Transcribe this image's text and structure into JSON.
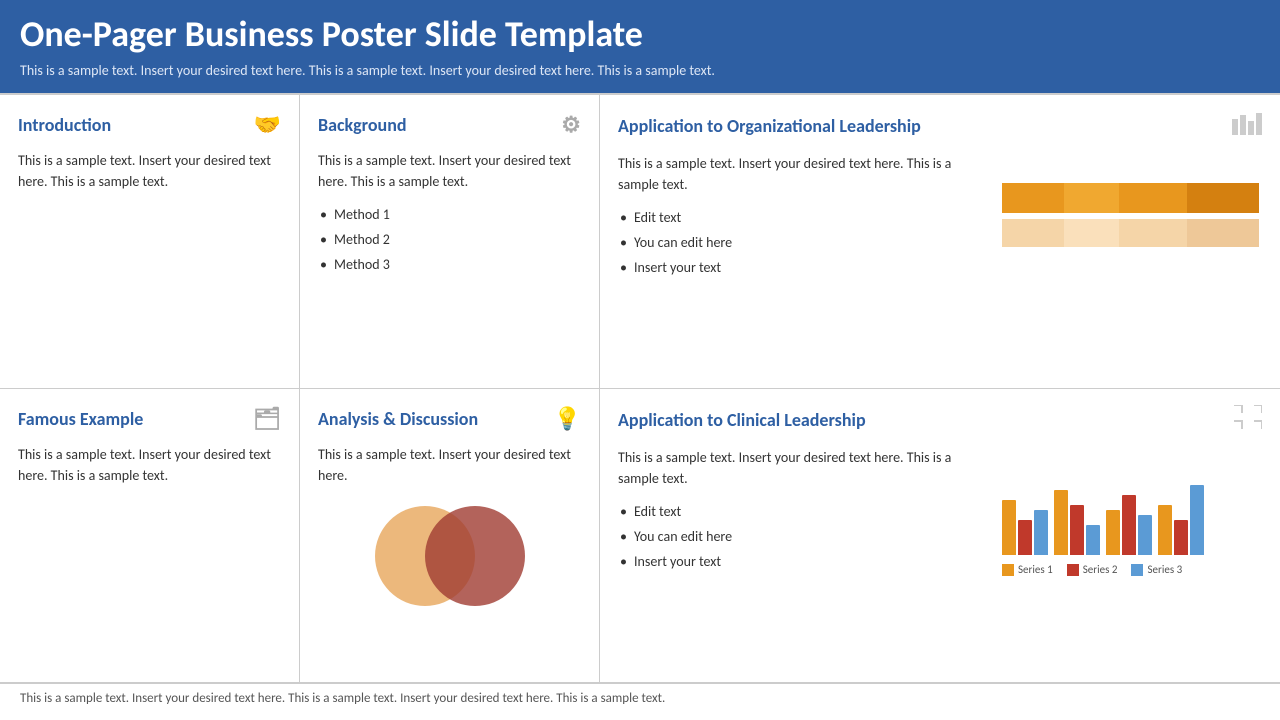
{
  "header": {
    "title": "One-Pager Business Poster Slide Template",
    "subtitle": "This is a sample text. Insert your desired text here. This is a sample text. Insert your desired text here. This is a sample text."
  },
  "sections": {
    "introduction": {
      "title": "Introduction",
      "icon": "🤝",
      "body": "This is a sample text. Insert your desired text here. This is a sample text."
    },
    "background": {
      "title": "Background",
      "icon": "⚙",
      "body": "This is a sample text. Insert your desired text here. This is a sample text.",
      "list": [
        "Method 1",
        "Method 2",
        "Method 3"
      ]
    },
    "org_leadership": {
      "title": "Application to Organizational Leadership",
      "icon": "📊",
      "body": "This is a sample text. Insert your desired text here. This is a sample text.",
      "list": [
        "Edit text",
        "You can edit here",
        "Insert your text"
      ]
    },
    "famous_example": {
      "title": "Famous Example",
      "icon": "🗂",
      "body": "This is a sample text. Insert your desired text here. This is a sample text."
    },
    "analysis": {
      "title": "Analysis & Discussion",
      "icon": "💡",
      "body": "This is a sample text. Insert your desired text here."
    },
    "clinical_leadership": {
      "title": "Application to Clinical Leadership",
      "icon": "🔀",
      "body": "This is a sample text. Insert your desired text here. This is a sample text.",
      "list": [
        "Edit text",
        "You can edit here",
        "Insert your text"
      ],
      "legend": [
        "Series 1",
        "Series 2",
        "Series 3"
      ]
    }
  },
  "footer": {
    "text": "This is a sample text. Insert your desired text here. This is a sample text. Insert your desired text here. This is a sample text."
  },
  "colors": {
    "blue": "#2E5FA3",
    "orange": "#E8971E",
    "orange_light": "#F5D5A8",
    "red_dark": "#A03030",
    "series1": "#E8971E",
    "series2": "#C0392B",
    "series3": "#5B9BD5"
  }
}
